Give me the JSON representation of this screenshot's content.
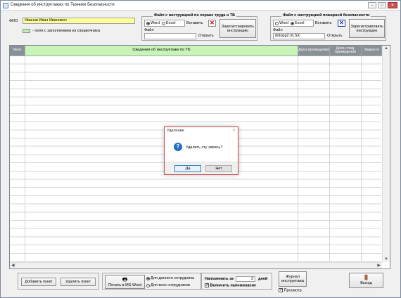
{
  "window": {
    "title": "Сведения об инструктажах по Технике Безопасности",
    "min_glyph": "–",
    "max_glyph": "□",
    "close_glyph": "✕"
  },
  "header": {
    "fio_label": "ФИО",
    "fio_value": "Иванов Иван Иванович",
    "legend_text": "- поля с заполнением из справочника"
  },
  "labor_group": {
    "title": "Файл с инструкцией по охране труда и ТБ",
    "radio_word": "Word",
    "radio_excel": "Excel",
    "selected": "Word",
    "insert_label": "Вставить",
    "file_label": "Файл",
    "file_value": "",
    "open_label": "Открыть",
    "register_label": "Зарегистрировать инструкцию"
  },
  "fire_group": {
    "title": "Файл с инструкцией пожарной безопасности",
    "radio_word": "Word",
    "radio_excel": "Excel",
    "selected": "Excel",
    "insert_label": "Вставить",
    "file_label": "Файл",
    "file_value": "dolopg2.XLSX",
    "open_label": "Открыть",
    "register_label": "Зарегистрировать инструкцию"
  },
  "table": {
    "columns": [
      {
        "label": "№пп",
        "style": "dark"
      },
      {
        "label": "Сведения об инструктаже по ТБ",
        "style": "green"
      },
      {
        "label": "Дата проведения",
        "style": "dark"
      },
      {
        "label": "Дата след. проведения",
        "style": "dark"
      },
      {
        "label": "Закрыто",
        "style": "dark"
      }
    ],
    "rows": []
  },
  "bottom": {
    "add_label": "Добавить пункт",
    "delete_label": "Удалить пункт",
    "print_label": "Печать в MS Word",
    "print_radio_current": "Для данного сотрудника",
    "print_radio_all": "Для всех сотрудников",
    "print_selected": "current",
    "remind_label": "Напоминать за",
    "remind_value": "3",
    "remind_unit": "дней",
    "enable_remind_label": "Включить напоминание",
    "enable_remind_checked": true,
    "journal_label": "Журнал инструктажа",
    "preview_label": "Просмотр",
    "preview_checked": true,
    "exit_label": "Выход"
  },
  "dialog": {
    "title": "Удаление",
    "message": "Удалить эту запись?",
    "yes_label": "Да",
    "no_label": "Нет",
    "icon": "question-icon",
    "close_glyph": "✕"
  },
  "colors": {
    "fio_bg": "#ffff99",
    "legend_green": "#b8f0b0",
    "header_green": "#c8f4b8",
    "header_dark": "#8a9098",
    "dialog_border": "#c24848",
    "question_blue": "#1f6fc4"
  }
}
